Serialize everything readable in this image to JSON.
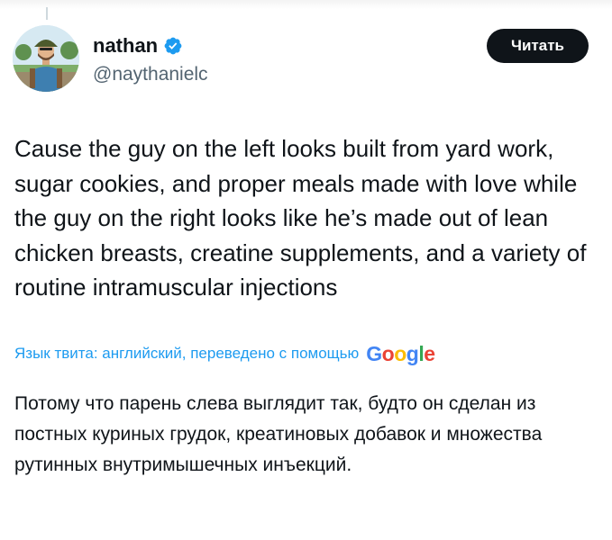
{
  "author": {
    "display_name": "nathan",
    "handle": "@naythanielc",
    "verified": true
  },
  "follow_button": {
    "label": "Читать"
  },
  "tweet": {
    "text": "Cause the guy on the left looks built from yard work, sugar cookies, and proper meals made with love while the guy on the right looks like he’s made out of lean chicken breasts, creatine supplements, and a variety of routine intramuscular injections"
  },
  "translation": {
    "note": "Язык твита: английский, переведено с помощью",
    "provider": "Google",
    "text": "Потому что парень слева выглядит так, будто он сделан из постных куриных грудок, креатиновых добавок и множества рутинных внутримышечных инъекций."
  },
  "colors": {
    "accent": "#1d9bf0",
    "text": "#0f1419",
    "secondary": "#536471",
    "button_bg": "#0f1419",
    "google_blue": "#4285f4",
    "google_red": "#ea4335",
    "google_yellow": "#fbbc05",
    "google_green": "#34a853"
  },
  "icons": {
    "verified": "verified-badge-icon"
  }
}
